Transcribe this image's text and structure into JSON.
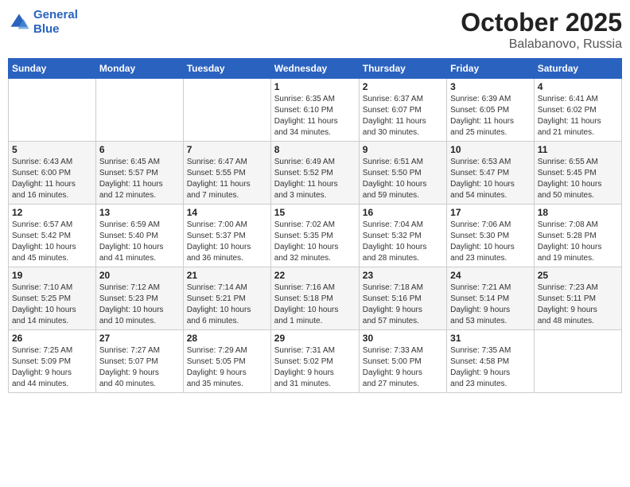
{
  "header": {
    "logo_line1": "General",
    "logo_line2": "Blue",
    "month": "October 2025",
    "location": "Balabanovo, Russia"
  },
  "weekdays": [
    "Sunday",
    "Monday",
    "Tuesday",
    "Wednesday",
    "Thursday",
    "Friday",
    "Saturday"
  ],
  "rows": [
    [
      {
        "day": "",
        "info": ""
      },
      {
        "day": "",
        "info": ""
      },
      {
        "day": "",
        "info": ""
      },
      {
        "day": "1",
        "info": "Sunrise: 6:35 AM\nSunset: 6:10 PM\nDaylight: 11 hours\nand 34 minutes."
      },
      {
        "day": "2",
        "info": "Sunrise: 6:37 AM\nSunset: 6:07 PM\nDaylight: 11 hours\nand 30 minutes."
      },
      {
        "day": "3",
        "info": "Sunrise: 6:39 AM\nSunset: 6:05 PM\nDaylight: 11 hours\nand 25 minutes."
      },
      {
        "day": "4",
        "info": "Sunrise: 6:41 AM\nSunset: 6:02 PM\nDaylight: 11 hours\nand 21 minutes."
      }
    ],
    [
      {
        "day": "5",
        "info": "Sunrise: 6:43 AM\nSunset: 6:00 PM\nDaylight: 11 hours\nand 16 minutes."
      },
      {
        "day": "6",
        "info": "Sunrise: 6:45 AM\nSunset: 5:57 PM\nDaylight: 11 hours\nand 12 minutes."
      },
      {
        "day": "7",
        "info": "Sunrise: 6:47 AM\nSunset: 5:55 PM\nDaylight: 11 hours\nand 7 minutes."
      },
      {
        "day": "8",
        "info": "Sunrise: 6:49 AM\nSunset: 5:52 PM\nDaylight: 11 hours\nand 3 minutes."
      },
      {
        "day": "9",
        "info": "Sunrise: 6:51 AM\nSunset: 5:50 PM\nDaylight: 10 hours\nand 59 minutes."
      },
      {
        "day": "10",
        "info": "Sunrise: 6:53 AM\nSunset: 5:47 PM\nDaylight: 10 hours\nand 54 minutes."
      },
      {
        "day": "11",
        "info": "Sunrise: 6:55 AM\nSunset: 5:45 PM\nDaylight: 10 hours\nand 50 minutes."
      }
    ],
    [
      {
        "day": "12",
        "info": "Sunrise: 6:57 AM\nSunset: 5:42 PM\nDaylight: 10 hours\nand 45 minutes."
      },
      {
        "day": "13",
        "info": "Sunrise: 6:59 AM\nSunset: 5:40 PM\nDaylight: 10 hours\nand 41 minutes."
      },
      {
        "day": "14",
        "info": "Sunrise: 7:00 AM\nSunset: 5:37 PM\nDaylight: 10 hours\nand 36 minutes."
      },
      {
        "day": "15",
        "info": "Sunrise: 7:02 AM\nSunset: 5:35 PM\nDaylight: 10 hours\nand 32 minutes."
      },
      {
        "day": "16",
        "info": "Sunrise: 7:04 AM\nSunset: 5:32 PM\nDaylight: 10 hours\nand 28 minutes."
      },
      {
        "day": "17",
        "info": "Sunrise: 7:06 AM\nSunset: 5:30 PM\nDaylight: 10 hours\nand 23 minutes."
      },
      {
        "day": "18",
        "info": "Sunrise: 7:08 AM\nSunset: 5:28 PM\nDaylight: 10 hours\nand 19 minutes."
      }
    ],
    [
      {
        "day": "19",
        "info": "Sunrise: 7:10 AM\nSunset: 5:25 PM\nDaylight: 10 hours\nand 14 minutes."
      },
      {
        "day": "20",
        "info": "Sunrise: 7:12 AM\nSunset: 5:23 PM\nDaylight: 10 hours\nand 10 minutes."
      },
      {
        "day": "21",
        "info": "Sunrise: 7:14 AM\nSunset: 5:21 PM\nDaylight: 10 hours\nand 6 minutes."
      },
      {
        "day": "22",
        "info": "Sunrise: 7:16 AM\nSunset: 5:18 PM\nDaylight: 10 hours\nand 1 minute."
      },
      {
        "day": "23",
        "info": "Sunrise: 7:18 AM\nSunset: 5:16 PM\nDaylight: 9 hours\nand 57 minutes."
      },
      {
        "day": "24",
        "info": "Sunrise: 7:21 AM\nSunset: 5:14 PM\nDaylight: 9 hours\nand 53 minutes."
      },
      {
        "day": "25",
        "info": "Sunrise: 7:23 AM\nSunset: 5:11 PM\nDaylight: 9 hours\nand 48 minutes."
      }
    ],
    [
      {
        "day": "26",
        "info": "Sunrise: 7:25 AM\nSunset: 5:09 PM\nDaylight: 9 hours\nand 44 minutes."
      },
      {
        "day": "27",
        "info": "Sunrise: 7:27 AM\nSunset: 5:07 PM\nDaylight: 9 hours\nand 40 minutes."
      },
      {
        "day": "28",
        "info": "Sunrise: 7:29 AM\nSunset: 5:05 PM\nDaylight: 9 hours\nand 35 minutes."
      },
      {
        "day": "29",
        "info": "Sunrise: 7:31 AM\nSunset: 5:02 PM\nDaylight: 9 hours\nand 31 minutes."
      },
      {
        "day": "30",
        "info": "Sunrise: 7:33 AM\nSunset: 5:00 PM\nDaylight: 9 hours\nand 27 minutes."
      },
      {
        "day": "31",
        "info": "Sunrise: 7:35 AM\nSunset: 4:58 PM\nDaylight: 9 hours\nand 23 minutes."
      },
      {
        "day": "",
        "info": ""
      }
    ]
  ]
}
